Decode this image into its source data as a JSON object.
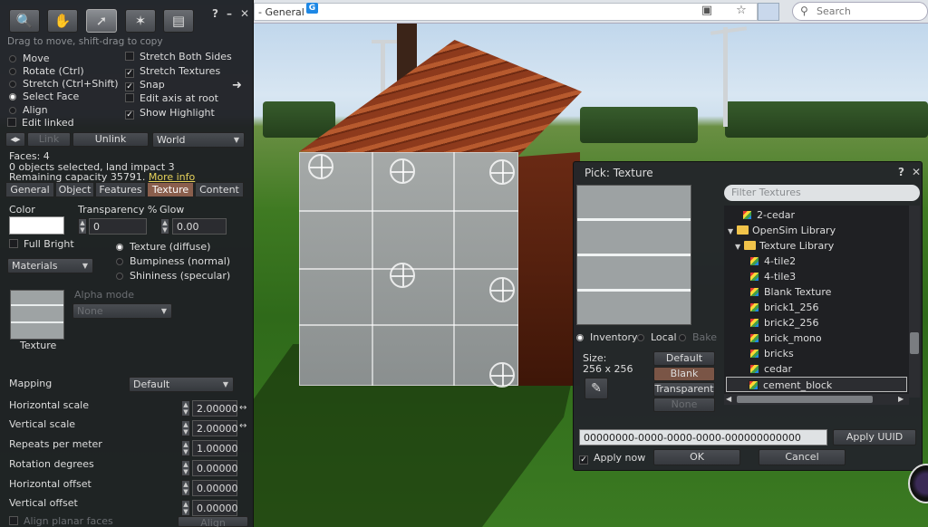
{
  "browser": {
    "address_text": "- General",
    "search_placeholder": "Search"
  },
  "build_panel": {
    "tools": [
      "focus",
      "move",
      "edit",
      "create",
      "land"
    ],
    "hint": "Drag to move, shift-drag to copy",
    "edit_modes": [
      {
        "label": "Move",
        "selected": false
      },
      {
        "label": "Rotate (Ctrl)",
        "selected": false
      },
      {
        "label": "Stretch (Ctrl+Shift)",
        "selected": false
      },
      {
        "label": "Select Face",
        "selected": true
      },
      {
        "label": "Align",
        "selected": false
      }
    ],
    "edit_linked": "Edit linked",
    "options": [
      {
        "label": "Stretch Both Sides",
        "checked": false
      },
      {
        "label": "Stretch Textures",
        "checked": true
      },
      {
        "label": "Snap",
        "checked": true
      },
      {
        "label": "Edit axis at root",
        "checked": false
      },
      {
        "label": "Show Highlight",
        "checked": true
      }
    ],
    "link_button": "Link",
    "unlink_button": "Unlink",
    "ruler": "World",
    "faces": "Faces: 4",
    "selection": "0 objects selected, land impact 3",
    "capacity": "Remaining capacity 35791.",
    "more_info": "More info",
    "tabs": [
      "General",
      "Object",
      "Features",
      "Texture",
      "Content"
    ],
    "active_tab": "Texture",
    "color_label": "Color",
    "transparency_label": "Transparency %",
    "transparency_value": "0",
    "glow_label": "Glow",
    "glow_value": "0.00",
    "full_bright": "Full Bright",
    "materials": "Materials",
    "map_types": [
      {
        "label": "Texture (diffuse)",
        "selected": true
      },
      {
        "label": "Bumpiness (normal)",
        "selected": false
      },
      {
        "label": "Shininess (specular)",
        "selected": false
      }
    ],
    "alpha_mode_label": "Alpha mode",
    "alpha_mode_value": "None",
    "texture_caption": "Texture",
    "mapping_label": "Mapping",
    "mapping_value": "Default",
    "params": [
      {
        "label": "Horizontal scale",
        "value": "2.00000"
      },
      {
        "label": "Vertical scale",
        "value": "2.00000"
      },
      {
        "label": "Repeats per meter",
        "value": "1.00000"
      },
      {
        "label": "Rotation degrees",
        "value": "0.00000"
      },
      {
        "label": "Horizontal offset",
        "value": "0.00000"
      },
      {
        "label": "Vertical offset",
        "value": "0.00000"
      }
    ],
    "align_planar": "Align planar faces",
    "align_button": "Align"
  },
  "texture_picker": {
    "title": "Pick: Texture",
    "filter_placeholder": "Filter Textures",
    "sources": [
      {
        "label": "Inventory",
        "selected": true
      },
      {
        "label": "Local",
        "selected": false
      },
      {
        "label": "Bake",
        "selected": false
      }
    ],
    "size_label": "Size:",
    "size_value": "256 x 256",
    "buttons": {
      "default": "Default",
      "blank": "Blank",
      "transparent": "Transparent",
      "none": "None"
    },
    "tree": [
      {
        "label": "2-cedar",
        "kind": "texture",
        "indent": 1
      },
      {
        "label": "OpenSim Library",
        "kind": "folder",
        "indent": 0
      },
      {
        "label": "Texture Library",
        "kind": "folder",
        "indent": 1
      },
      {
        "label": "4-tile2",
        "kind": "texture",
        "indent": 2
      },
      {
        "label": "4-tile3",
        "kind": "texture",
        "indent": 2
      },
      {
        "label": "Blank Texture",
        "kind": "texture",
        "indent": 2
      },
      {
        "label": "brick1_256",
        "kind": "texture",
        "indent": 2
      },
      {
        "label": "brick2_256",
        "kind": "texture",
        "indent": 2
      },
      {
        "label": "brick_mono",
        "kind": "texture",
        "indent": 2
      },
      {
        "label": "bricks",
        "kind": "texture",
        "indent": 2
      },
      {
        "label": "cedar",
        "kind": "texture",
        "indent": 2
      },
      {
        "label": "cement_block",
        "kind": "texture",
        "indent": 2,
        "selected": true
      }
    ],
    "uuid": "00000000-0000-0000-0000-000000000000",
    "apply_uuid": "Apply UUID",
    "apply_now": "Apply now",
    "ok": "OK",
    "cancel": "Cancel"
  }
}
